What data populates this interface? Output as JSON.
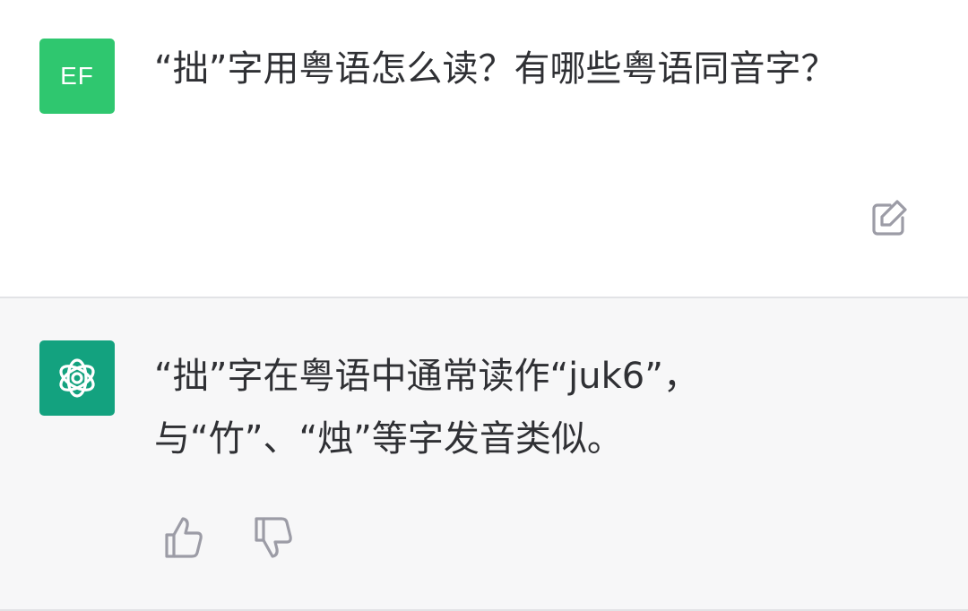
{
  "user_message": {
    "avatar_text": "EF",
    "text": "“拙”字用粤语怎么读？有哪些粤语同音字？",
    "edit_icon": "edit-icon"
  },
  "assistant_message": {
    "avatar_icon": "openai-logo-icon",
    "text": "“拙”字在粤语中通常读作“juk6”，与“竹”、“烛”等字发音类似。",
    "feedback_icons": [
      "thumbs-up-icon",
      "thumbs-down-icon"
    ]
  },
  "colors": {
    "user_avatar": "#2fc76f",
    "assistant_avatar": "#13a27f",
    "assistant_background": "#f7f7f8",
    "text": "#2f3034",
    "icon": "#9c9ca6"
  }
}
